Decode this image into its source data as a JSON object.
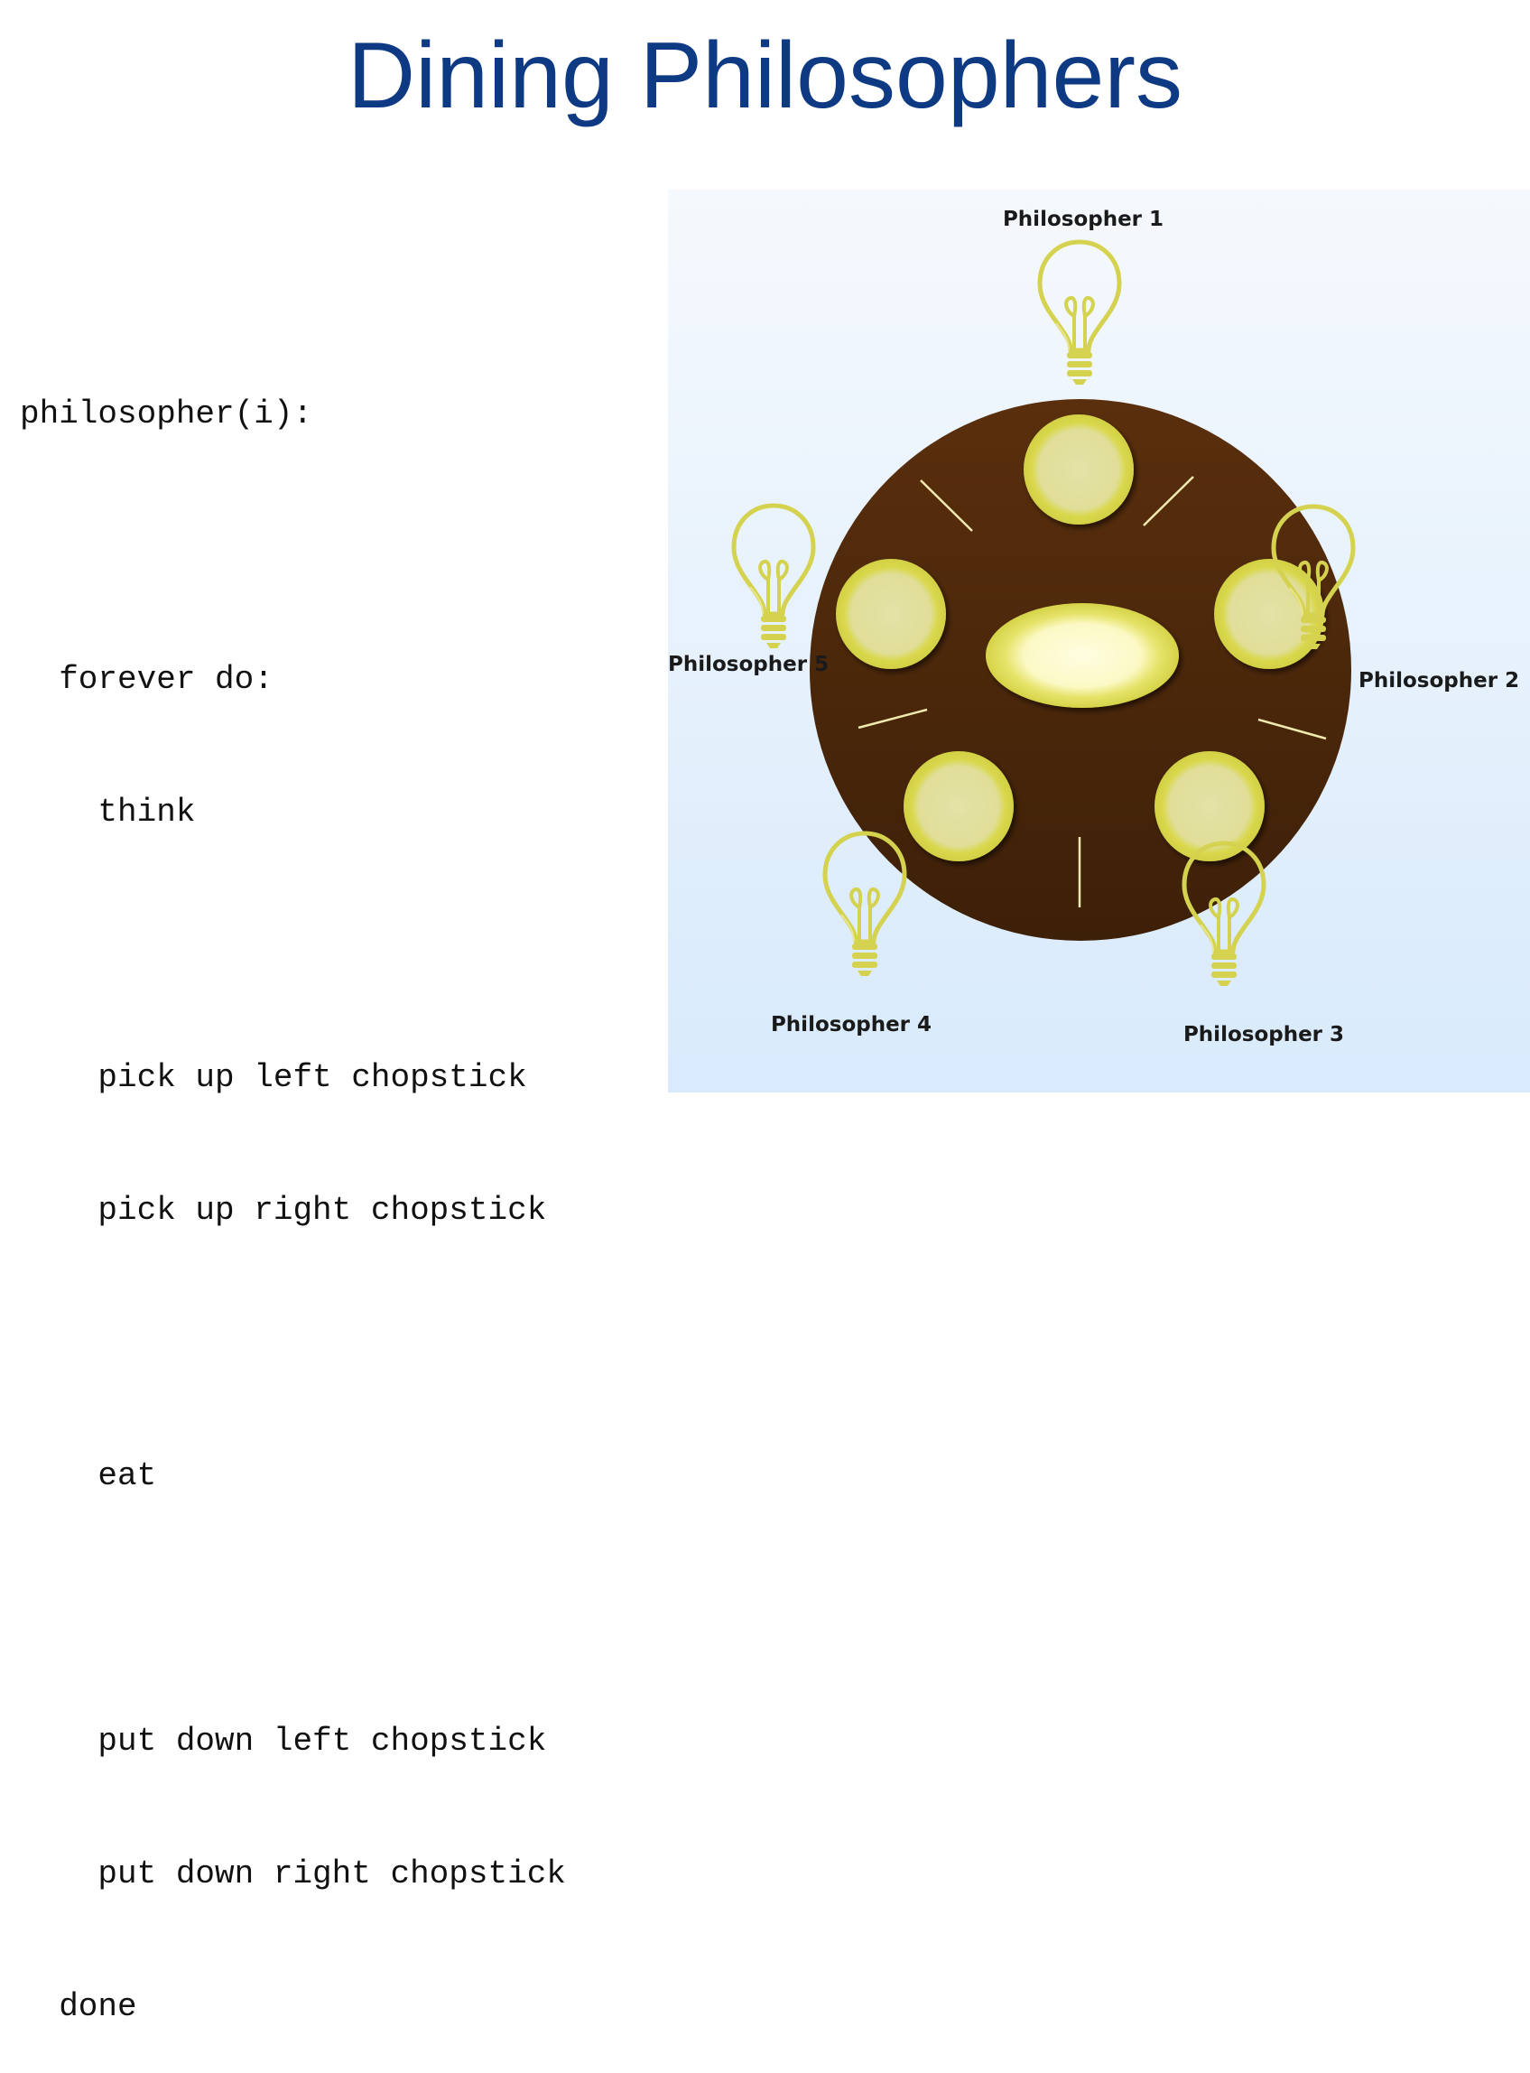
{
  "title": "Dining Philosophers",
  "code": {
    "lines": [
      "philosopher(i):",
      "",
      "  forever do:",
      "    think",
      "",
      "    pick up left chopstick",
      "    pick up right chopstick",
      "",
      "    eat",
      "",
      "    put down left chopstick",
      "    put down right chopstick",
      "  done"
    ]
  },
  "diagram": {
    "philosophers": [
      "Philosopher 1",
      "Philosopher 2",
      "Philosopher 3",
      "Philosopher 4",
      "Philosopher 5"
    ],
    "plate_count": 5,
    "chopstick_count": 5,
    "colors": {
      "table_top": "#5a2f0d",
      "table_bottom": "#3d2008",
      "plate_rim": "#d9d84d",
      "plate_center": "#e4e2a6",
      "bowl_center": "#fffde0",
      "bulb": "#d4d24f",
      "chopstick": "#f0eab0",
      "background_top": "#f5f9fd",
      "background_bottom": "#d8eafc"
    },
    "icons": [
      "lightbulb-icon"
    ]
  }
}
